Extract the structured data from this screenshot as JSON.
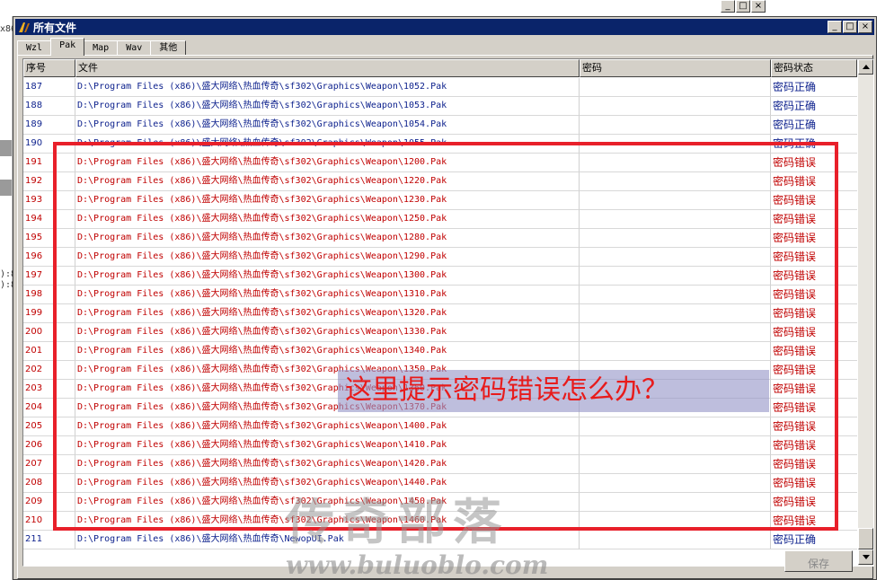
{
  "background_fragments": [
    "x86",
    "):8",
    "):8"
  ],
  "window": {
    "title": "所有文件",
    "controls": [
      "_",
      "□",
      "×"
    ]
  },
  "background_controls": [
    "_",
    "□",
    "×"
  ],
  "tabs": [
    {
      "label": "Wzl",
      "active": false
    },
    {
      "label": "Pak",
      "active": true
    },
    {
      "label": "Map",
      "active": false
    },
    {
      "label": "Wav",
      "active": false
    },
    {
      "label": "其他",
      "active": false
    }
  ],
  "columns": {
    "index": "序号",
    "file": "文件",
    "password": "密码",
    "status": "密码状态"
  },
  "rows": [
    {
      "no": "187",
      "file": "D:\\Program Files (x86)\\盛大网络\\热血传奇\\sf302\\Graphics\\Weapon\\1052.Pak",
      "password": "",
      "status": "密码正确",
      "state": "ok"
    },
    {
      "no": "188",
      "file": "D:\\Program Files (x86)\\盛大网络\\热血传奇\\sf302\\Graphics\\Weapon\\1053.Pak",
      "password": "",
      "status": "密码正确",
      "state": "ok"
    },
    {
      "no": "189",
      "file": "D:\\Program Files (x86)\\盛大网络\\热血传奇\\sf302\\Graphics\\Weapon\\1054.Pak",
      "password": "",
      "status": "密码正确",
      "state": "ok"
    },
    {
      "no": "190",
      "file": "D:\\Program Files (x86)\\盛大网络\\热血传奇\\sf302\\Graphics\\Weapon\\1055.Pak",
      "password": "",
      "status": "密码正确",
      "state": "ok"
    },
    {
      "no": "191",
      "file": "D:\\Program Files (x86)\\盛大网络\\热血传奇\\sf302\\Graphics\\Weapon\\1200.Pak",
      "password": "",
      "status": "密码错误",
      "state": "err"
    },
    {
      "no": "192",
      "file": "D:\\Program Files (x86)\\盛大网络\\热血传奇\\sf302\\Graphics\\Weapon\\1220.Pak",
      "password": "",
      "status": "密码错误",
      "state": "err"
    },
    {
      "no": "193",
      "file": "D:\\Program Files (x86)\\盛大网络\\热血传奇\\sf302\\Graphics\\Weapon\\1230.Pak",
      "password": "",
      "status": "密码错误",
      "state": "err"
    },
    {
      "no": "194",
      "file": "D:\\Program Files (x86)\\盛大网络\\热血传奇\\sf302\\Graphics\\Weapon\\1250.Pak",
      "password": "",
      "status": "密码错误",
      "state": "err"
    },
    {
      "no": "195",
      "file": "D:\\Program Files (x86)\\盛大网络\\热血传奇\\sf302\\Graphics\\Weapon\\1280.Pak",
      "password": "",
      "status": "密码错误",
      "state": "err"
    },
    {
      "no": "196",
      "file": "D:\\Program Files (x86)\\盛大网络\\热血传奇\\sf302\\Graphics\\Weapon\\1290.Pak",
      "password": "",
      "status": "密码错误",
      "state": "err"
    },
    {
      "no": "197",
      "file": "D:\\Program Files (x86)\\盛大网络\\热血传奇\\sf302\\Graphics\\Weapon\\1300.Pak",
      "password": "",
      "status": "密码错误",
      "state": "err"
    },
    {
      "no": "198",
      "file": "D:\\Program Files (x86)\\盛大网络\\热血传奇\\sf302\\Graphics\\Weapon\\1310.Pak",
      "password": "",
      "status": "密码错误",
      "state": "err"
    },
    {
      "no": "199",
      "file": "D:\\Program Files (x86)\\盛大网络\\热血传奇\\sf302\\Graphics\\Weapon\\1320.Pak",
      "password": "",
      "status": "密码错误",
      "state": "err"
    },
    {
      "no": "200",
      "file": "D:\\Program Files (x86)\\盛大网络\\热血传奇\\sf302\\Graphics\\Weapon\\1330.Pak",
      "password": "",
      "status": "密码错误",
      "state": "err"
    },
    {
      "no": "201",
      "file": "D:\\Program Files (x86)\\盛大网络\\热血传奇\\sf302\\Graphics\\Weapon\\1340.Pak",
      "password": "",
      "status": "密码错误",
      "state": "err"
    },
    {
      "no": "202",
      "file": "D:\\Program Files (x86)\\盛大网络\\热血传奇\\sf302\\Graphics\\Weapon\\1350.Pak",
      "password": "",
      "status": "密码错误",
      "state": "err"
    },
    {
      "no": "203",
      "file": "D:\\Program Files (x86)\\盛大网络\\热血传奇\\sf302\\Graphics\\Weapon\\1360.Pak",
      "password": "",
      "status": "密码错误",
      "state": "err"
    },
    {
      "no": "204",
      "file": "D:\\Program Files (x86)\\盛大网络\\热血传奇\\sf302\\Graphics\\Weapon\\1370.Pak",
      "password": "",
      "status": "密码错误",
      "state": "err"
    },
    {
      "no": "205",
      "file": "D:\\Program Files (x86)\\盛大网络\\热血传奇\\sf302\\Graphics\\Weapon\\1400.Pak",
      "password": "",
      "status": "密码错误",
      "state": "err"
    },
    {
      "no": "206",
      "file": "D:\\Program Files (x86)\\盛大网络\\热血传奇\\sf302\\Graphics\\Weapon\\1410.Pak",
      "password": "",
      "status": "密码错误",
      "state": "err"
    },
    {
      "no": "207",
      "file": "D:\\Program Files (x86)\\盛大网络\\热血传奇\\sf302\\Graphics\\Weapon\\1420.Pak",
      "password": "",
      "status": "密码错误",
      "state": "err"
    },
    {
      "no": "208",
      "file": "D:\\Program Files (x86)\\盛大网络\\热血传奇\\sf302\\Graphics\\Weapon\\1440.Pak",
      "password": "",
      "status": "密码错误",
      "state": "err"
    },
    {
      "no": "209",
      "file": "D:\\Program Files (x86)\\盛大网络\\热血传奇\\sf302\\Graphics\\Weapon\\1450.Pak",
      "password": "",
      "status": "密码错误",
      "state": "err"
    },
    {
      "no": "210",
      "file": "D:\\Program Files (x86)\\盛大网络\\热血传奇\\sf302\\Graphics\\Weapon\\1460.Pak",
      "password": "",
      "status": "密码错误",
      "state": "err"
    },
    {
      "no": "211",
      "file": "D:\\Program Files (x86)\\盛大网络\\热血传奇\\NewopUI.Pak",
      "password": "",
      "status": "密码正确",
      "state": "ok"
    }
  ],
  "save_button": "保存",
  "annotation": {
    "callout": "这里提示密码错误怎么办？",
    "box_color": "#e8202a"
  },
  "watermark": {
    "text": "传奇部落",
    "url": "www.buluoblo.com"
  },
  "colors": {
    "ok_text": "#0b1f8c",
    "error_text": "#c00000",
    "titlebar": "#0a246a"
  }
}
